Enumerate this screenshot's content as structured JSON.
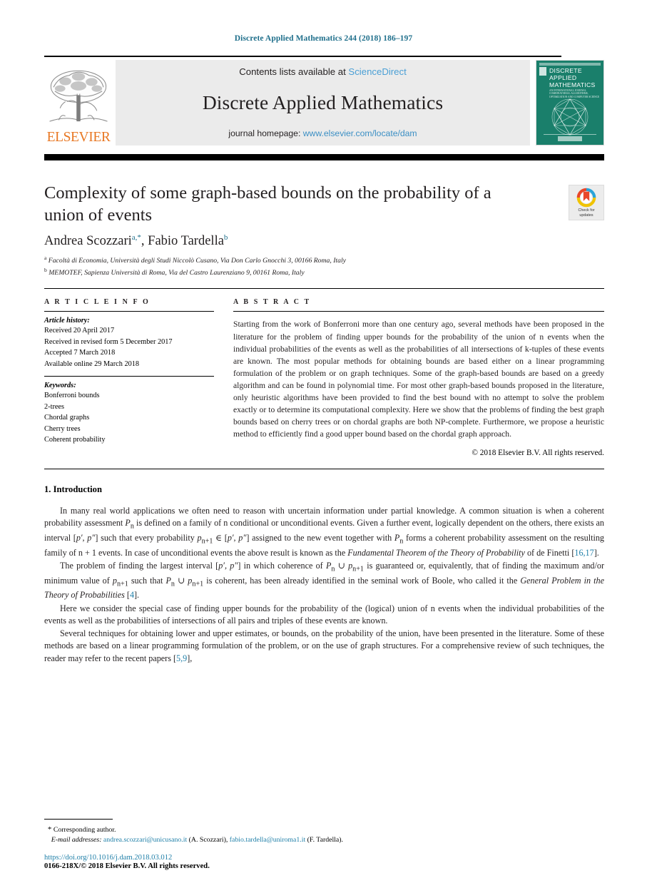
{
  "running_head": "Discrete Applied Mathematics 244 (2018) 186–197",
  "masthead": {
    "contents_prefix": "Contents lists available at ",
    "sciencedirect": "ScienceDirect",
    "journal_name": "Discrete Applied Mathematics",
    "homepage_prefix": "journal homepage: ",
    "homepage_url": "www.elsevier.com/locate/dam",
    "publisher": "ELSEVIER",
    "cover_title": "DISCRETE APPLIED MATHEMATICS",
    "cover_subtitle": "AN INTERNATIONAL JOURNAL COMBINATORIAL ALGORITHMS, OPTIMIZATION AND COMPUTER SCIENCE",
    "link_color": "#3b8fc4",
    "cover_color": "#1a7f6b",
    "elsevier_orange": "#E87722"
  },
  "article": {
    "title": "Complexity of some graph-based bounds on the probability of a union of events",
    "authors_plain": "Andrea Scozzari",
    "author1_name": "Andrea Scozzari",
    "author1_sup": "a",
    "author1_star": ",*",
    "author2_name": "Fabio Tardella",
    "author2_sup": "b",
    "affiliation_a_mark": "a",
    "affiliation_a": "Facoltà di Economia, Università degli Studi Niccolò Cusano, Via Don Carlo Gnocchi 3, 00166 Roma, Italy",
    "affiliation_b_mark": "b",
    "affiliation_b": "MEMOTEF, Sapienza Università di Roma, Via del Castro Laurenziano 9, 00161 Roma, Italy",
    "crossmark_line1": "Check for",
    "crossmark_line2": "updates"
  },
  "info": {
    "heading": "A R T I C L E   I N F O",
    "history_label": "Article history:",
    "history": [
      "Received 20 April 2017",
      "Received in revised form 5 December 2017",
      "Accepted 7 March 2018",
      "Available online 29 March 2018"
    ],
    "keywords_label": "Keywords:",
    "keywords": [
      "Bonferroni bounds",
      "2-trees",
      "Chordal graphs",
      "Cherry trees",
      "Coherent probability"
    ]
  },
  "abstract": {
    "heading": "A B S T R A C T",
    "text": "Starting from the work of Bonferroni more than one century ago, several methods have been proposed in the literature for the problem of finding upper bounds for the probability of the union of n events when the individual probabilities of the events as well as the probabilities of all intersections of k-tuples of these events are known. The most popular methods for obtaining bounds are based either on a linear programming formulation of the problem or on graph techniques. Some of the graph-based bounds are based on a greedy algorithm and can be found in polynomial time. For most other graph-based bounds proposed in the literature, only heuristic algorithms have been provided to find the best bound with no attempt to solve the problem exactly or to determine its computational complexity. Here we show that the problems of finding the best graph bounds based on cherry trees or on chordal graphs are both NP-complete. Furthermore, we propose a heuristic method to efficiently find a good upper bound based on the chordal graph approach.",
    "copyright": "© 2018 Elsevier B.V. All rights reserved."
  },
  "body": {
    "section_number_title": "1. Introduction",
    "p1_a": "In many real world applications we often need to reason with uncertain information under partial knowledge. A common situation is when a coherent probability assessment ",
    "p1_sym1": "P",
    "p1_sub1": "n",
    "p1_b": " is defined on a family of n conditional or unconditional events. Given a further event, logically dependent on the others, there exists an interval [",
    "p1_pp": "p′, p″",
    "p1_c": "] such that every probability ",
    "p1_sym2": "p",
    "p1_sub2": "n+1",
    "p1_d": " ∈ [",
    "p1_e": "] assigned to the new event together with ",
    "p1_f": " forms a coherent probability assessment on the resulting family of n + 1 events. In case of unconditional events the above result is known as the ",
    "p1_em": "Fundamental Theorem of the Theory of Probability",
    "p1_g": " of de Finetti [",
    "p1_cite1": "16,17",
    "p1_h": "].",
    "p2_a": "The problem of finding the largest interval [",
    "p2_b": "] in which coherence of ",
    "p2_c": " ∪ ",
    "p2_d": " is guaranteed or, equivalently, that of finding the maximum and/or minimum value of ",
    "p2_e": " such that ",
    "p2_f": " is coherent, has been already identified in the seminal work of Boole, who called it the ",
    "p2_em": "General Problem in the Theory of Probabilities",
    "p2_g": " [",
    "p2_cite": "4",
    "p2_h": "].",
    "p3": "Here we consider the special case of finding upper bounds for the probability of the (logical) union of n events when the individual probabilities of the events as well as the probabilities of intersections of all pairs and triples of these events are known.",
    "p4_a": "Several techniques for obtaining lower and upper estimates, or bounds, on the probability of the union, have been presented in the literature. Some of these methods are based on a linear programming formulation of the problem, or on the use of graph structures. For a comprehensive review of such techniques, the reader may refer to the recent papers [",
    "p4_cite": "5,9",
    "p4_b": "],"
  },
  "footnotes": {
    "star": "*",
    "corresponding": "Corresponding author.",
    "email_label": "E-mail addresses:",
    "email1": "andrea.scozzari@unicusano.it",
    "email1_owner": "(A. Scozzari),",
    "email2": "fabio.tardella@uniroma1.it",
    "email2_owner": "(F. Tardella)."
  },
  "footer": {
    "doi": "https://doi.org/10.1016/j.dam.2018.03.012",
    "issn": "0166-218X/© 2018 Elsevier B.V. All rights reserved."
  }
}
